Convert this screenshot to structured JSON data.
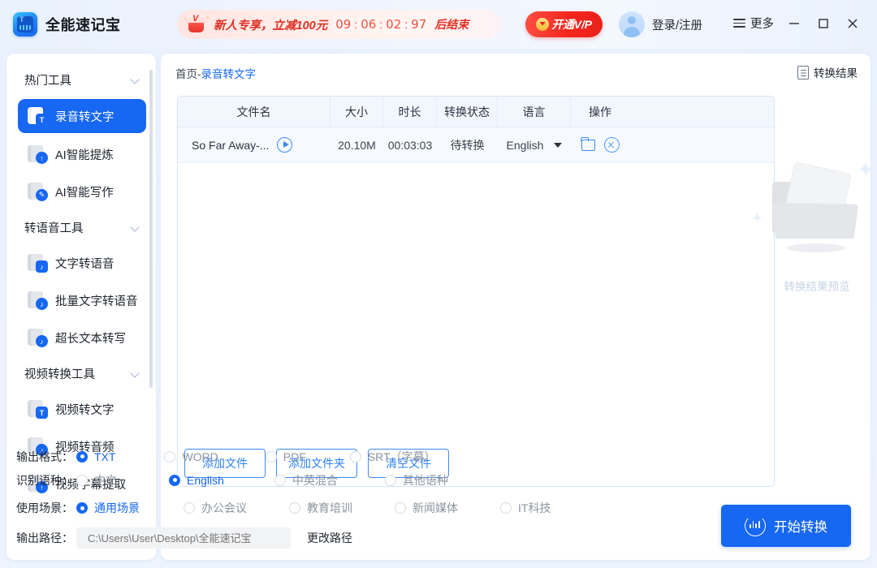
{
  "titlebar": {
    "app_name": "全能速记宝",
    "logo_icon": "app-logo-icon",
    "promo": {
      "gift_icon": "gift-box-icon",
      "badge_text": "V",
      "text": "新人专享，立减100元",
      "timer": {
        "hours": "09",
        "minutes": "06",
        "seconds": "02",
        "millis": "97",
        "separator": ":"
      },
      "end_text": "后结束"
    },
    "vip_button": {
      "label": "开通V/P",
      "icon": "vip-diamond-icon",
      "color": "#ef2119"
    },
    "login": {
      "label": "登录/注册",
      "avatar_icon": "user-avatar-icon"
    },
    "more": {
      "label": "更多",
      "icon": "hamburger-menu-icon"
    },
    "window": {
      "minimize": "minimize-icon",
      "maximize": "maximize-icon",
      "close": "close-icon"
    }
  },
  "sidebar": {
    "groups": [
      {
        "label": "热门工具",
        "chevron": "chevron-down-icon",
        "items": [
          {
            "label": "录音转文字",
            "icon": "audio-to-text-icon",
            "badge": "T",
            "badge_shape": "square",
            "active": true
          },
          {
            "label": "AI智能提炼",
            "icon": "ai-extract-icon",
            "badge": "↑",
            "badge_shape": "circle",
            "active": false
          },
          {
            "label": "AI智能写作",
            "icon": "ai-write-icon",
            "badge": "✎",
            "badge_shape": "circle",
            "active": false
          }
        ]
      },
      {
        "label": "转语音工具",
        "chevron": "chevron-down-icon",
        "items": [
          {
            "label": "文字转语音",
            "icon": "text-to-speech-icon",
            "badge": "♪",
            "badge_shape": "square",
            "active": false
          },
          {
            "label": "批量文字转语音",
            "icon": "batch-text-to-speech-icon",
            "badge": "♪",
            "badge_shape": "circle",
            "active": false
          },
          {
            "label": "超长文本转写",
            "icon": "long-text-transcribe-icon",
            "badge": "♪",
            "badge_shape": "circle",
            "active": false
          }
        ]
      },
      {
        "label": "视频转换工具",
        "chevron": "chevron-down-icon",
        "items": [
          {
            "label": "视频转文字",
            "icon": "video-to-text-icon",
            "badge": "T",
            "badge_shape": "square",
            "active": false
          },
          {
            "label": "视频转音频",
            "icon": "video-to-audio-icon",
            "badge": "♪",
            "badge_shape": "circle",
            "active": false
          },
          {
            "label": "视频字幕提取",
            "icon": "video-subtitle-extract-icon",
            "badge": "↑",
            "badge_shape": "circle",
            "active": false
          }
        ]
      }
    ],
    "active_color": "#1667f2"
  },
  "main": {
    "breadcrumb": {
      "home": "首页",
      "separator": "-",
      "current": "录音转文字"
    },
    "result_link": {
      "label": "转换结果",
      "icon": "document-result-icon"
    },
    "table": {
      "columns": [
        "文件名",
        "大小",
        "时长",
        "转换状态",
        "语言",
        "操作"
      ],
      "rows": [
        {
          "filename": "So Far Away-...",
          "play_icon": "play-circle-icon",
          "size": "20.10M",
          "duration": "00:03:03",
          "status": "待转换",
          "language": "English",
          "language_caret": "caret-down-icon",
          "folder_icon": "open-folder-icon",
          "remove_icon": "remove-circle-icon"
        }
      ]
    },
    "panel_buttons": [
      {
        "label": "添加文件",
        "name": "add-file-button"
      },
      {
        "label": "添加文件夹",
        "name": "add-folder-button"
      },
      {
        "label": "清空文件",
        "name": "clear-files-button"
      }
    ],
    "preview": {
      "label": "转换结果预览",
      "icon": "empty-folder-illustration"
    }
  },
  "options": {
    "output_format": {
      "label": "输出格式：",
      "choices": [
        {
          "label": "TXT",
          "selected": true
        },
        {
          "label": "WORD",
          "selected": false
        },
        {
          "label": "PDF",
          "selected": false
        },
        {
          "label": "SRT（字幕）",
          "selected": false
        }
      ]
    },
    "language": {
      "label": "识别语种：",
      "choices": [
        {
          "label": "中文",
          "selected": false
        },
        {
          "label": "English",
          "selected": true
        },
        {
          "label": "中英混合",
          "selected": false
        },
        {
          "label": "其他语种",
          "selected": false
        }
      ]
    },
    "scene": {
      "label": "使用场景：",
      "choices": [
        {
          "label": "通用场景",
          "selected": true
        },
        {
          "label": "办公会议",
          "selected": false
        },
        {
          "label": "教育培训",
          "selected": false
        },
        {
          "label": "新闻媒体",
          "selected": false
        },
        {
          "label": "IT科技",
          "selected": false
        }
      ]
    },
    "output_path": {
      "label": "输出路径：",
      "value": "C:\\Users\\User\\Desktop\\全能速记宝",
      "change_label": "更改路径"
    }
  },
  "start_button": {
    "label": "开始转换",
    "icon": "waveform-icon",
    "color": "#1667f2"
  }
}
